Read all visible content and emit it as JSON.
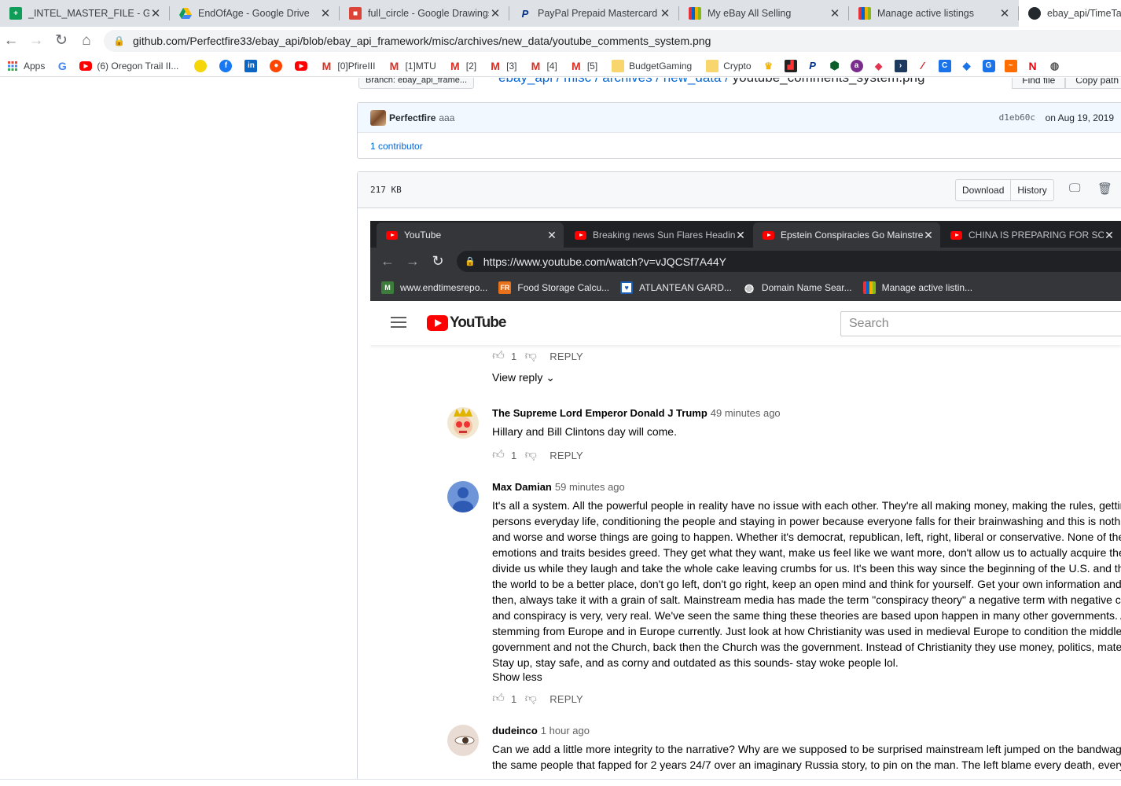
{
  "browser": {
    "tabs": [
      {
        "title": "_INTEL_MASTER_FILE - Goog",
        "icon": "google-sheets-icon",
        "color": "#0f9d58"
      },
      {
        "title": "EndOfAge - Google Drive",
        "icon": "google-drive-icon",
        "color": "#fbbc04"
      },
      {
        "title": "full_circle - Google Drawings",
        "icon": "google-drawings-icon",
        "color": "#db4437"
      },
      {
        "title": "PayPal Prepaid Mastercard",
        "icon": "paypal-icon",
        "color": "#003087"
      },
      {
        "title": "My eBay All Selling",
        "icon": "ebay-icon",
        "color": "#e53238"
      },
      {
        "title": "Manage active listings",
        "icon": "ebay-icon",
        "color": "#e53238"
      },
      {
        "title": "ebay_api/TimeTabl",
        "icon": "github-icon",
        "color": "#24292e"
      }
    ],
    "url": "github.com/Perfectfire33/ebay_api/blob/ebay_api_framework/misc/archives/new_data/youtube_comments_system.png",
    "bookmarks": {
      "apps": "Apps",
      "oregon": "(6) Oregon Trail II...",
      "pfire": "[0]PfireIII",
      "mtu": "[1]MTU",
      "g2": "[2]",
      "g3": "[3]",
      "g4": "[4]",
      "g5": "[5]",
      "budget": "BudgetGaming",
      "crypto": "Crypto"
    }
  },
  "github": {
    "branch": "Branch: ebay_api_frame...",
    "breadcrumb": "ebay_api / misc / archives / new_data /",
    "filename": "youtube_comments_system.png",
    "find_file": "Find file",
    "copy_path": "Copy path",
    "author": "Perfectfire",
    "commit_msg": "aaa",
    "sha": "d1eb60c",
    "date": "on Aug 19, 2019",
    "contributors": "1 contributor",
    "size": "217 KB",
    "download": "Download",
    "history": "History"
  },
  "embedded": {
    "tabs": [
      {
        "title": "YouTube"
      },
      {
        "title": "Breaking news Sun Flares Headin"
      },
      {
        "title": "Epstein Conspiracies Go Mainstre"
      },
      {
        "title": "CHINA IS PREPARING FOR SOME"
      }
    ],
    "url": "https://www.youtube.com/watch?v=vJQCSf7A44Y",
    "bookmarks": [
      "www.endtimesrepo...",
      "Food Storage Calcu...",
      "ATLANTEAN GARD...",
      "Domain Name Sear...",
      "Manage active listin..."
    ],
    "logo": "YouTube",
    "search_placeholder": "Search",
    "comments": {
      "c0": {
        "likes": "1",
        "reply": "REPLY",
        "view_reply": "View reply"
      },
      "c1": {
        "name": "The Supreme Lord Emperor Donald J Trump",
        "time": "49 minutes ago",
        "text": "Hillary and Bill Clintons day will come.",
        "likes": "1",
        "reply": "REPLY"
      },
      "c2": {
        "name": "Max Damian",
        "time": "59 minutes ago",
        "lines": [
          "It's all a system. All the powerful people in reality have no issue with each other. They're all making money, making the rules, gettin",
          "persons everyday life, conditioning the people and staying in power because everyone falls for their brainwashing and this is nothi",
          "and worse and worse things are going to happen. Whether it's democrat, republican, left, right, liberal or conservative. None of thes",
          "emotions and traits besides greed. They get what they want, make us feel like we want more, don't allow us to actually acquire the",
          "divide us while they laugh and take the whole cake leaving crumbs for us. It's been this way since the beginning of the U.S. and tho",
          "the world to be a better place, don't go left, don't go right, keep an open mind and think for yourself. Get your own information and",
          "then, always take it with a grain of salt. Mainstream media has made the term \"conspiracy theory\" a negative term with negative c",
          "and conspiracy is very, very real. We've seen the same thing these theories are based upon happen in many other governments. Al",
          "stemming from Europe and in Europe currently. Just look at how Christianity was used in medieval Europe to condition the middle",
          "government and not the Church, back then the Church was the government. Instead of Christianity they use money, politics, mater",
          "Stay up, stay safe, and as corny and outdated as this sounds- stay woke people lol."
        ],
        "show_less": "Show less",
        "likes": "1",
        "reply": "REPLY"
      },
      "c3": {
        "name": "dudeinco",
        "time": "1 hour ago",
        "lines": [
          "Can we add a little more integrity to the narrative?  Why are we supposed to be surprised mainstream left jumped on the bandwag",
          "the same people that fapped for 2 years 24/7 over an imaginary Russia story, to pin on the man.  The left blame every death, every"
        ]
      }
    }
  }
}
